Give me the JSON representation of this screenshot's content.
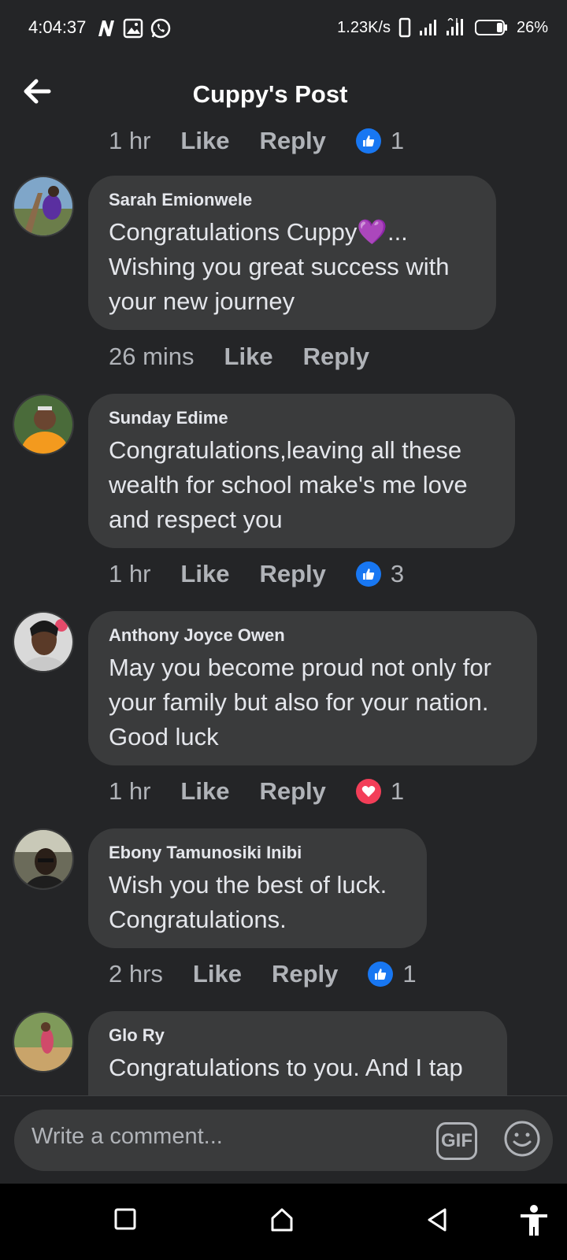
{
  "status_bar": {
    "time": "4:04:37",
    "network_speed": "1.23K/s",
    "battery": "26%"
  },
  "header": {
    "title": "Cuppy's Post"
  },
  "top_meta": {
    "time": "1 hr",
    "like": "Like",
    "reply": "Reply",
    "reaction": "like",
    "count": "1"
  },
  "comments": [
    {
      "author": "Sarah Emionwele",
      "text_line1": "Congratulations Cuppy💜...",
      "text_line2": "Wishing you great success with",
      "text_line3": "your new journey",
      "time": "26 mins",
      "like": "Like",
      "reply": "Reply"
    },
    {
      "author": "Sunday Edime",
      "text_line1": "Congratulations,leaving all these",
      "text_line2": "wealth for school make's me love",
      "text_line3": "and respect you",
      "time": "1 hr",
      "like": "Like",
      "reply": "Reply",
      "reaction": "like",
      "count": "3"
    },
    {
      "author": "Anthony Joyce Owen",
      "text_line1": "May you become proud not only for",
      "text_line2": "your family but also for your nation.",
      "text_line3": "Good luck",
      "time": "1 hr",
      "like": "Like",
      "reply": "Reply",
      "reaction": "love",
      "count": "1"
    },
    {
      "author": "Ebony Tamunosiki Inibi",
      "text_line1": "Wish you the best of luck.",
      "text_line2": "Congratulations.",
      "time": "2 hrs",
      "like": "Like",
      "reply": "Reply",
      "reaction": "like",
      "count": "1"
    },
    {
      "author": "Glo Ry",
      "text_line1": "Congratulations to you. And I tap"
    }
  ],
  "composer": {
    "placeholder": "Write a comment...",
    "gif_label": "GIF"
  },
  "colors": {
    "background": "#242527",
    "bubble": "#3a3b3c",
    "like_blue": "#1877f2",
    "love_red": "#f33e58"
  }
}
